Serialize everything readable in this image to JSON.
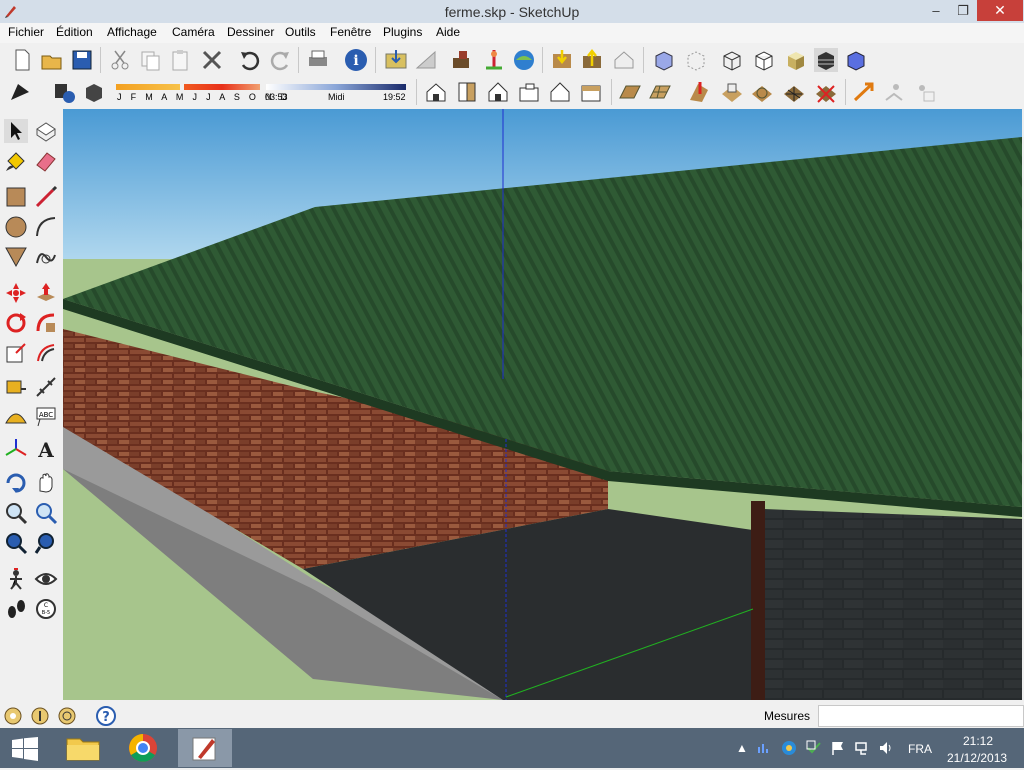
{
  "window": {
    "title": "ferme.skp - SketchUp",
    "minimize": "–",
    "restore": "❐",
    "close": "✕"
  },
  "menu": [
    "Fichier",
    "Édition",
    "Affichage",
    "Caméra",
    "Dessiner",
    "Outils",
    "Fenêtre",
    "Plugins",
    "Aide"
  ],
  "shadow": {
    "months": "J F M A M J J A S O N D",
    "sunrise": "03:53",
    "noon": "Midi",
    "sunset": "19:52"
  },
  "status": {
    "measure_label": "Mesures",
    "measure_value": ""
  },
  "taskbar": {
    "language": "FRA",
    "time": "21:12",
    "date": "21/12/2013"
  },
  "colors": {
    "sky": "#6fb3e0",
    "ground": "#a7c58c",
    "roof": "#2f5a34",
    "brick": "#7a3a26",
    "concrete": "#8e8e8e",
    "axis_blue": "#1f2fd0",
    "axis_green": "#21b021",
    "taskbar": "#556678"
  },
  "icons": {
    "toolbar_row1": [
      "new-icon",
      "open-icon",
      "save-icon",
      "cut-icon",
      "copy-icon",
      "paste-icon",
      "erase-selection-icon",
      "undo-icon",
      "redo-icon",
      "print-icon",
      "model-info-icon",
      "get-models-icon",
      "share-model-icon",
      "share-component-icon",
      "add-location-icon",
      "toggle-terrain-icon",
      "photo-textures-icon",
      "get-models-3dwarehouse-icon",
      "export-model-icon",
      "preview-google-earth-icon",
      "xray-icon",
      "back-edges-icon",
      "wireframe-icon",
      "hidden-line-icon",
      "shaded-icon",
      "shaded-textures-icon",
      "monochrome-icon"
    ],
    "toolbar_row2": [
      "style-icon",
      "shadows-info-icon",
      "shadow-toggle-icon",
      "iso-view-icon",
      "top-view-icon",
      "front-view-icon",
      "right-view-icon",
      "back-view-icon",
      "left-view-icon",
      "sandbox-from-contours-icon",
      "sandbox-from-scratch-icon",
      "smoove-icon",
      "stamp-icon",
      "drape-icon",
      "add-detail-icon",
      "flip-edge-icon",
      "solid-union-icon",
      "solid-subtract-icon",
      "solid-trim-icon"
    ]
  }
}
